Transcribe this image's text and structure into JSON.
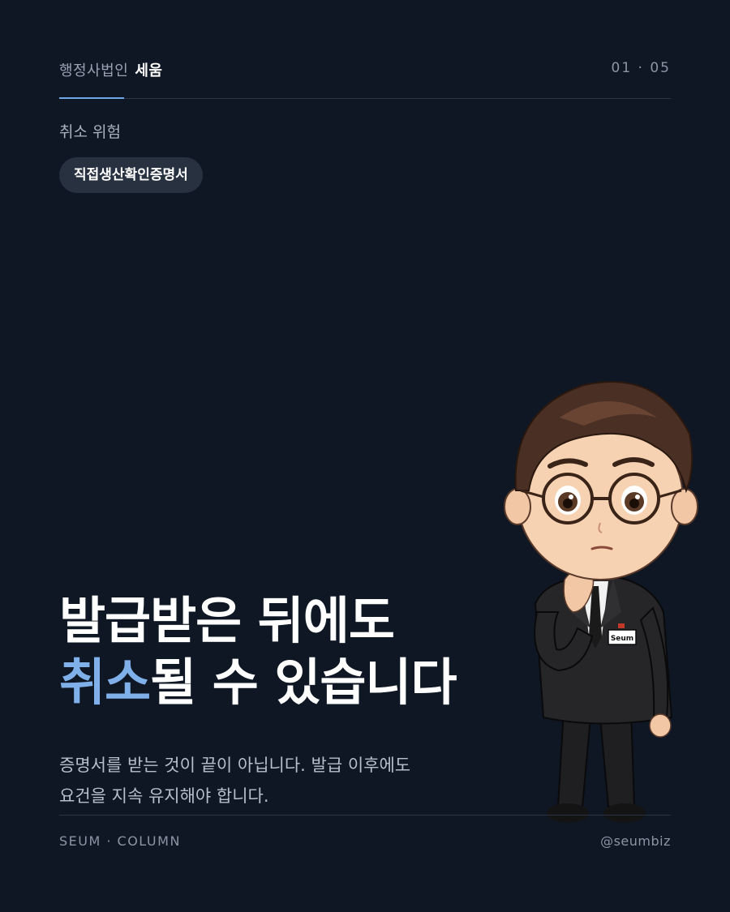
{
  "header": {
    "brand_sub": "행정사법인",
    "brand_main": "세움",
    "page_indicator": "01 · 05"
  },
  "category": "취소 위험",
  "tag": "직접생산확인증명서",
  "headline": {
    "line1": "발급받은 뒤에도",
    "line2_accent": "취소",
    "line2_rest": "될 수 있습니다"
  },
  "description": {
    "line1": "증명서를 받는 것이 끝이 아닙니다. 발급 이후에도",
    "line2": "요건을 지속 유지해야 합니다."
  },
  "character": {
    "badge_text": "Seum"
  },
  "footer": {
    "left": "SEUM · COLUMN",
    "right": "@seumbiz"
  },
  "colors": {
    "background": "#0f1724",
    "accent": "#7fb0ea",
    "tag_bg": "#273140"
  }
}
